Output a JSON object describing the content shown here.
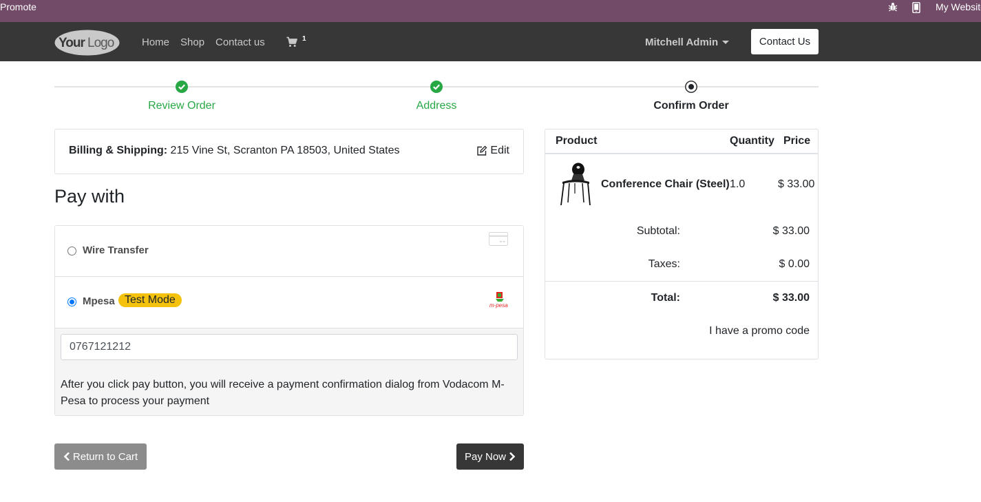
{
  "adminbar": {
    "promote": "Promote",
    "site": "My Website",
    "bug_icon": "bug-icon",
    "mobile_icon": "mobile-icon"
  },
  "navbar": {
    "logo_text": "YourLogo",
    "links": [
      "Home",
      "Shop",
      "Contact us"
    ],
    "cart_count": "1",
    "user": "Mitchell Admin",
    "contact_button": "Contact Us"
  },
  "steps": [
    {
      "label": "Review Order",
      "state": "done"
    },
    {
      "label": "Address",
      "state": "done"
    },
    {
      "label": "Confirm Order",
      "state": "active"
    }
  ],
  "billing": {
    "label": "Billing & Shipping:",
    "address": "215 Vine St, Scranton PA 18503, United States",
    "edit": "Edit"
  },
  "payment": {
    "title": "Pay with",
    "methods": [
      {
        "name": "Wire Transfer",
        "selected": false,
        "icon": "credit-card-icon"
      },
      {
        "name": "Mpesa",
        "selected": true,
        "badge": "Test Mode",
        "icon": "mpesa-icon"
      }
    ],
    "phone_value": "0767121212",
    "help_text": "After you click pay button, you will receive a payment confirmation dialog from Vodacom M-Pesa to process your payment"
  },
  "buttons": {
    "back": "Return to Cart",
    "pay": "Pay Now"
  },
  "summary": {
    "headers": {
      "product": "Product",
      "quantity": "Quantity",
      "price": "Price"
    },
    "item": {
      "name": "Conference Chair (Steel)",
      "quantity": "1.0",
      "price": "$ 33.00"
    },
    "subtotal_label": "Subtotal:",
    "subtotal": "$ 33.00",
    "taxes_label": "Taxes:",
    "taxes": "$ 0.00",
    "total_label": "Total:",
    "total": "$ 33.00",
    "promo": "I have a promo code"
  },
  "colors": {
    "admin_bar": "#714b67",
    "navbar": "#373737",
    "done": "#28a745",
    "badge": "#f4c20d"
  }
}
